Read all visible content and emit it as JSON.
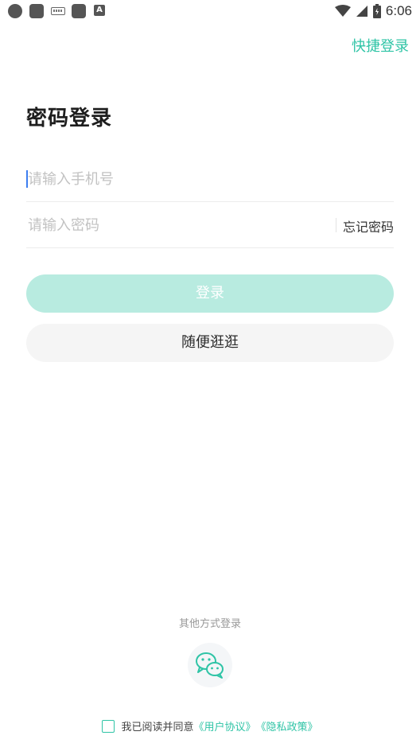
{
  "status_bar": {
    "time": "6:06"
  },
  "header": {
    "quick_login": "快捷登录"
  },
  "page": {
    "title": "密码登录"
  },
  "form": {
    "phone_placeholder": "请输入手机号",
    "password_placeholder": "请输入密码",
    "forgot_password": "忘记密码"
  },
  "buttons": {
    "login": "登录",
    "browse": "随便逛逛"
  },
  "footer": {
    "other_methods": "其他方式登录",
    "agree_text": "我已阅读并同意",
    "user_agreement": "《用户协议》",
    "privacy_policy": "《隐私政策》"
  },
  "colors": {
    "accent": "#2fc4a6",
    "login_button_disabled": "#b8ebe0",
    "secondary_button": "#f5f5f5"
  },
  "icons": [
    "wechat-icon",
    "wifi-icon",
    "signal-icon",
    "battery-icon",
    "keyboard-icon"
  ]
}
